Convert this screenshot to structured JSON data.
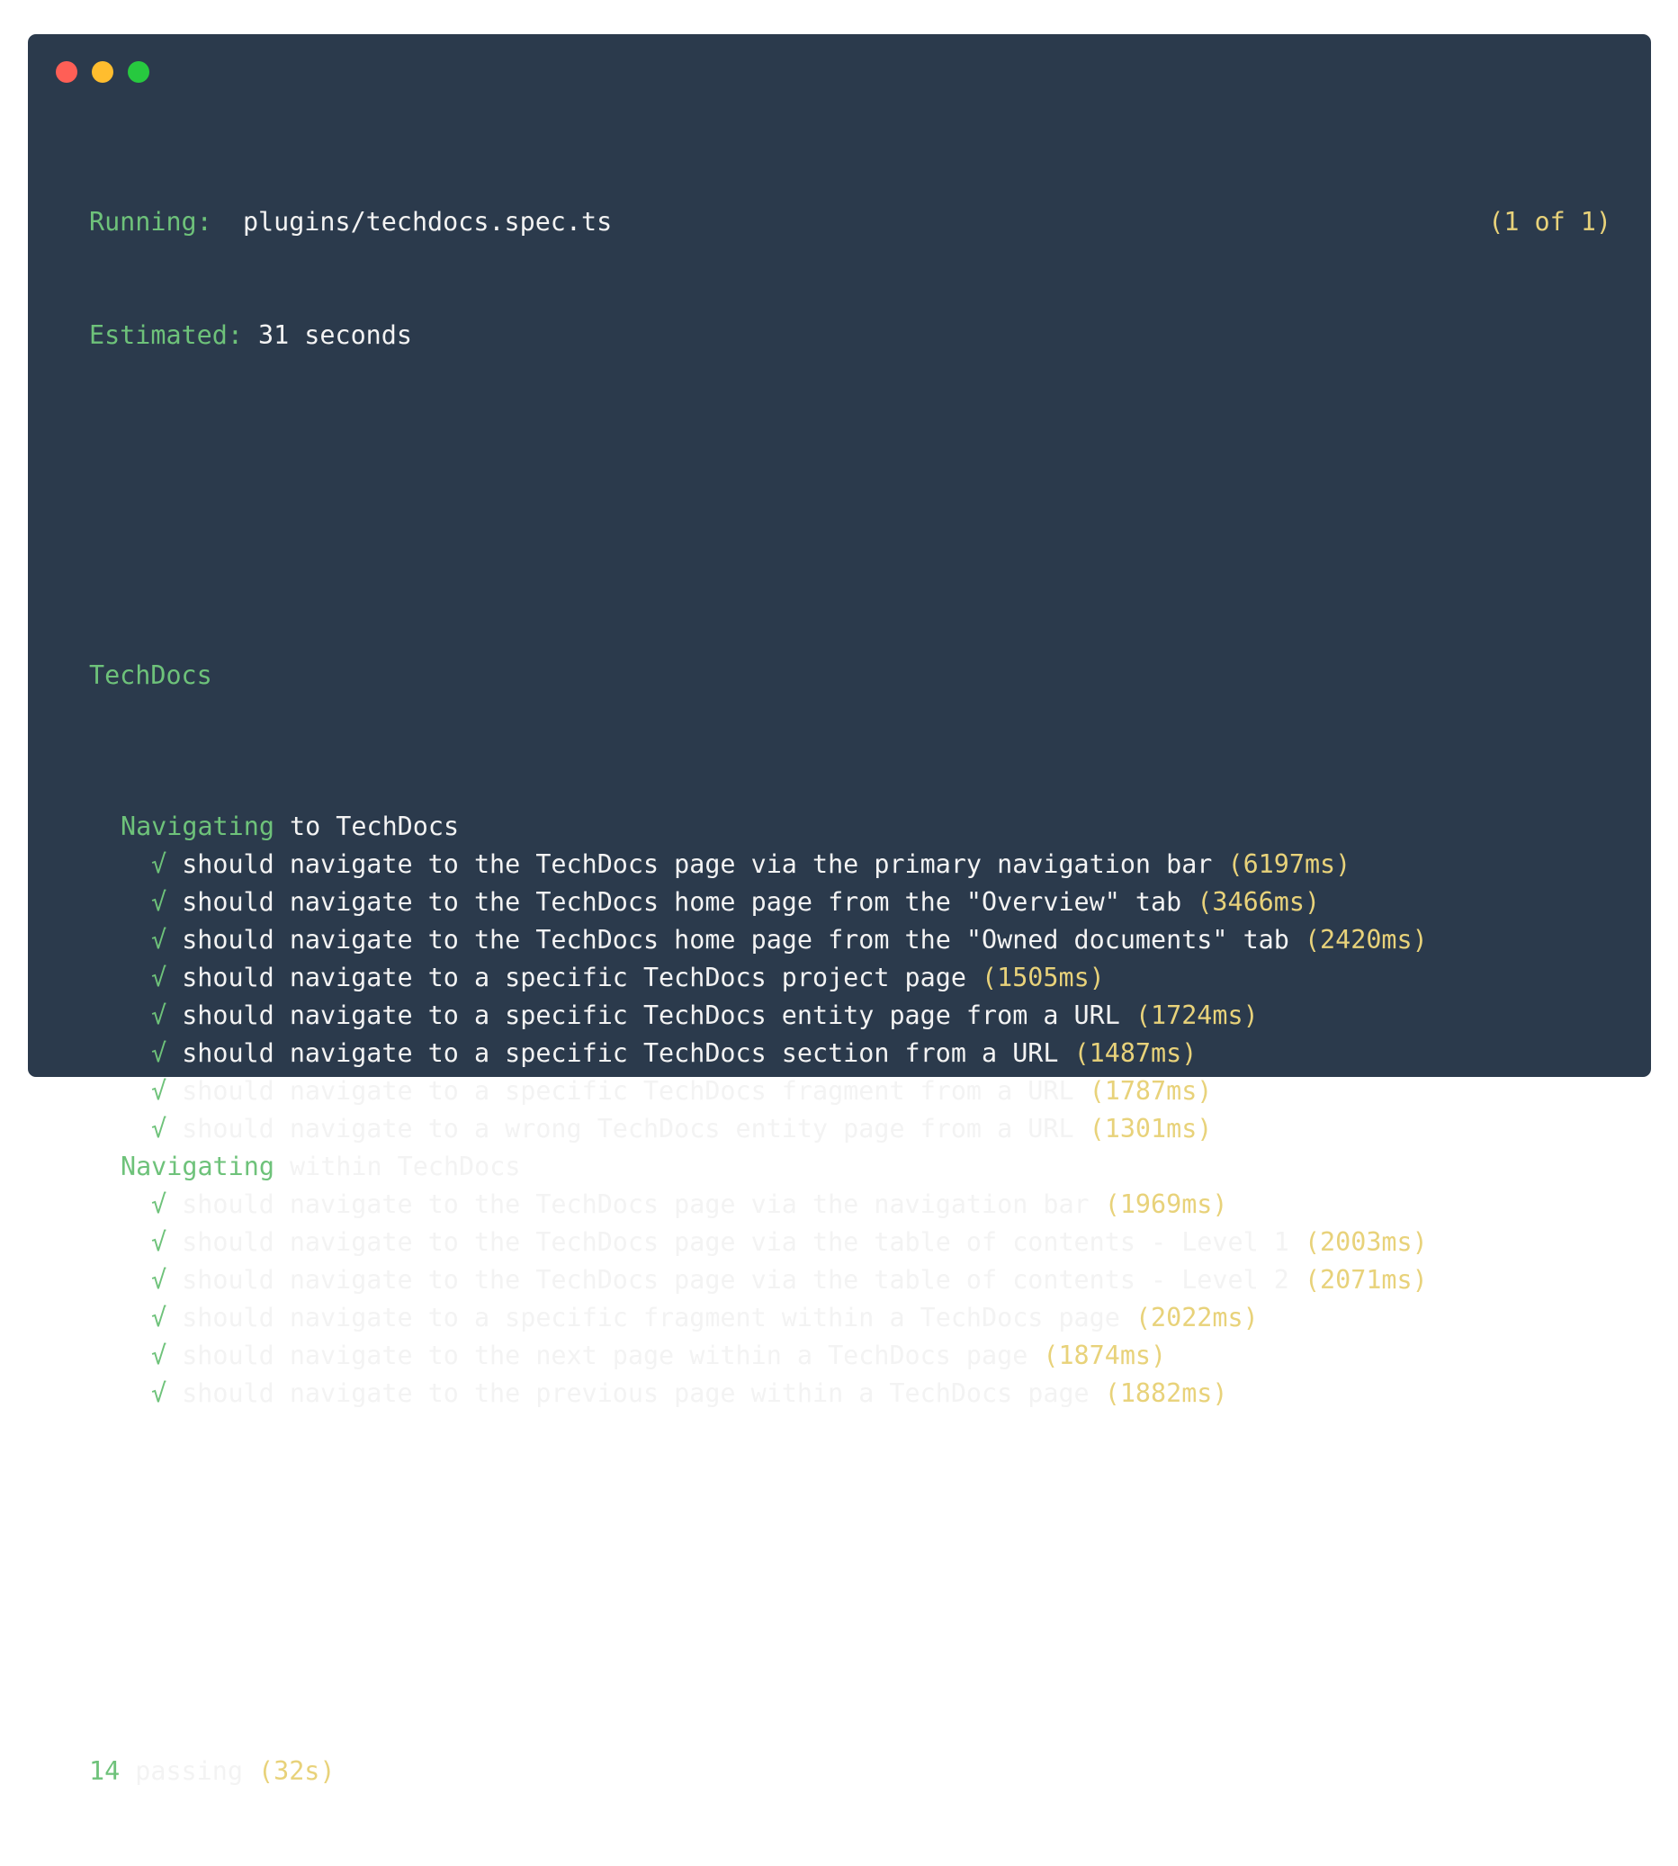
{
  "window": {
    "buttons": [
      {
        "name": "close",
        "color": "#ff5f56"
      },
      {
        "name": "minimize",
        "color": "#ffbd2e"
      },
      {
        "name": "maximize",
        "color": "#27c93f"
      }
    ]
  },
  "header": {
    "running_label": "Running:",
    "running_value": "plugins/techdocs.spec.ts",
    "counter": "(1 of 1)",
    "estimated_label": "Estimated:",
    "estimated_value": "31 seconds"
  },
  "suite": {
    "title": "TechDocs",
    "groups": [
      {
        "keyword": "Navigating",
        "rest": "to TechDocs",
        "tests": [
          {
            "check": "√",
            "text": "should navigate to the TechDocs page via the primary navigation bar",
            "duration": "(6197ms)"
          },
          {
            "check": "√",
            "text": "should navigate to the TechDocs home page from the \"Overview\" tab",
            "duration": "(3466ms)"
          },
          {
            "check": "√",
            "text": "should navigate to the TechDocs home page from the \"Owned documents\" tab",
            "duration": "(2420ms)"
          },
          {
            "check": "√",
            "text": "should navigate to a specific TechDocs project page",
            "duration": "(1505ms)"
          },
          {
            "check": "√",
            "text": "should navigate to a specific TechDocs entity page from a URL",
            "duration": "(1724ms)"
          },
          {
            "check": "√",
            "text": "should navigate to a specific TechDocs section from a URL",
            "duration": "(1487ms)"
          },
          {
            "check": "√",
            "text": "should navigate to a specific TechDocs fragment from a URL",
            "duration": "(1787ms)"
          },
          {
            "check": "√",
            "text": "should navigate to a wrong TechDocs entity page from a URL",
            "duration": "(1301ms)"
          }
        ]
      },
      {
        "keyword": "Navigating",
        "rest": "within TechDocs",
        "tests": [
          {
            "check": "√",
            "text": "should navigate to the TechDocs page via the navigation bar",
            "duration": "(1969ms)"
          },
          {
            "check": "√",
            "text": "should navigate to the TechDocs page via the table of contents - Level 1",
            "duration": "(2003ms)"
          },
          {
            "check": "√",
            "text": "should navigate to the TechDocs page via the table of contents - Level 2",
            "duration": "(2071ms)"
          },
          {
            "check": "√",
            "text": "should navigate to a specific fragment within a TechDocs page",
            "duration": "(2022ms)"
          },
          {
            "check": "√",
            "text": "should navigate to the next page within a TechDocs page",
            "duration": "(1874ms)"
          },
          {
            "check": "√",
            "text": "should navigate to the previous page within a TechDocs page",
            "duration": "(1882ms)"
          }
        ]
      }
    ]
  },
  "summary": {
    "count": "14",
    "label": "passing",
    "time": "(32s)"
  },
  "colors": {
    "background": "#2b3a4c",
    "green": "#6ec27a",
    "yellow": "#e8d27a",
    "text": "#f3f3f3"
  }
}
